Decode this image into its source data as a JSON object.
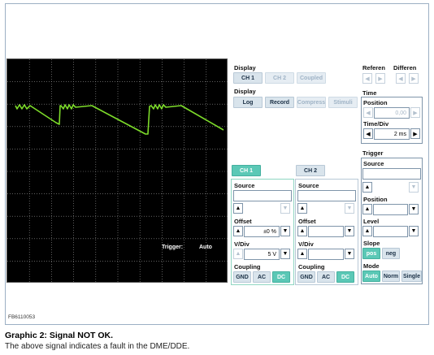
{
  "scope": {
    "trigger_label": "Trigger:",
    "trigger_value": "Auto"
  },
  "display": {
    "title": "Display",
    "row1": [
      "CH 1",
      "CH 2",
      "Coupled"
    ],
    "title2": "Display",
    "row2": [
      "Log",
      "Record",
      "Compress",
      "Stimuli"
    ]
  },
  "ref": {
    "referen": "Referen",
    "differen": "Differen"
  },
  "time": {
    "title": "Time",
    "position_label": "Position",
    "position_value": "0,00",
    "timediv_label": "Time/Div",
    "timediv_value": "2 ms"
  },
  "trigger": {
    "title": "Trigger",
    "source_label": "Source",
    "position_label": "Position",
    "level_label": "Level",
    "slope_label": "Slope",
    "slope_pos": "pos",
    "slope_neg": "neg",
    "mode_label": "Mode",
    "mode_auto": "Auto",
    "mode_norm": "Norm",
    "mode_single": "Single"
  },
  "ch1": {
    "tab": "CH 1",
    "source_label": "Source",
    "offset_label": "Offset",
    "offset_value": "±0 %",
    "vdiv_label": "V/Div",
    "vdiv_value": "5 V",
    "coupling_label": "Coupling",
    "gnd": "GND",
    "ac": "AC",
    "dc": "DC"
  },
  "ch2": {
    "tab": "CH 2",
    "source_label": "Source",
    "offset_label": "Offset",
    "vdiv_label": "V/Div",
    "coupling_label": "Coupling",
    "gnd": "GND",
    "ac": "AC",
    "dc": "DC"
  },
  "figure_ref": "FB6110053",
  "caption": {
    "title": "Graphic 2: Signal NOT OK.",
    "text": "The above signal indicates a fault in the DME/DDE."
  },
  "colors": {
    "trace": "#7ddc2a",
    "accent": "#5bc8b6",
    "grid": "#9a9a9a"
  }
}
